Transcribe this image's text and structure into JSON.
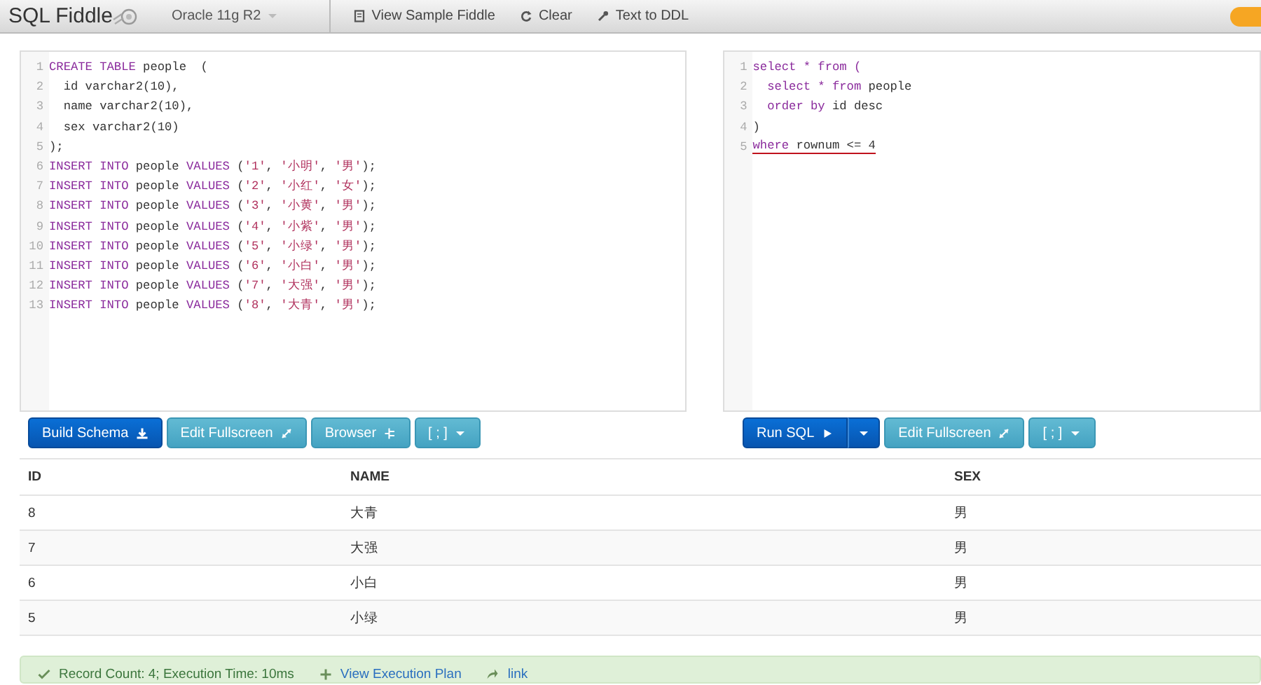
{
  "header": {
    "brand": "SQL Fiddle",
    "database": "Oracle 11g R2",
    "nav": [
      {
        "kind": "sample",
        "label": "View Sample Fiddle"
      },
      {
        "kind": "clear",
        "label": "Clear"
      },
      {
        "kind": "ddl",
        "label": "Text to DDL"
      }
    ]
  },
  "schema_editor": {
    "lines": [
      {
        "number": "1",
        "tokens": [
          {
            "kind": "keyword",
            "text": "CREATE TABLE"
          },
          {
            "kind": "plain",
            "text": " people  ("
          }
        ]
      },
      {
        "number": "2",
        "tokens": [
          {
            "kind": "plain",
            "text": "  id varchar2(10),"
          }
        ]
      },
      {
        "number": "3",
        "tokens": [
          {
            "kind": "plain",
            "text": "  name varchar2(10),"
          }
        ]
      },
      {
        "number": "4",
        "tokens": [
          {
            "kind": "plain",
            "text": "  sex varchar2(10)"
          }
        ]
      },
      {
        "number": "5",
        "tokens": [
          {
            "kind": "plain",
            "text": ");"
          }
        ]
      },
      {
        "number": "6",
        "tokens": [
          {
            "kind": "keyword",
            "text": "INSERT INTO"
          },
          {
            "kind": "plain",
            "text": " people "
          },
          {
            "kind": "keyword",
            "text": "VALUES"
          },
          {
            "kind": "plain",
            "text": " ("
          },
          {
            "kind": "string",
            "text": "'1'"
          },
          {
            "kind": "plain",
            "text": ", "
          },
          {
            "kind": "string",
            "text": "'小明'"
          },
          {
            "kind": "plain",
            "text": ", "
          },
          {
            "kind": "string",
            "text": "'男'"
          },
          {
            "kind": "plain",
            "text": ");"
          }
        ]
      },
      {
        "number": "7",
        "tokens": [
          {
            "kind": "keyword",
            "text": "INSERT INTO"
          },
          {
            "kind": "plain",
            "text": " people "
          },
          {
            "kind": "keyword",
            "text": "VALUES"
          },
          {
            "kind": "plain",
            "text": " ("
          },
          {
            "kind": "string",
            "text": "'2'"
          },
          {
            "kind": "plain",
            "text": ", "
          },
          {
            "kind": "string",
            "text": "'小红'"
          },
          {
            "kind": "plain",
            "text": ", "
          },
          {
            "kind": "string",
            "text": "'女'"
          },
          {
            "kind": "plain",
            "text": ");"
          }
        ]
      },
      {
        "number": "8",
        "tokens": [
          {
            "kind": "keyword",
            "text": "INSERT INTO"
          },
          {
            "kind": "plain",
            "text": " people "
          },
          {
            "kind": "keyword",
            "text": "VALUES"
          },
          {
            "kind": "plain",
            "text": " ("
          },
          {
            "kind": "string",
            "text": "'3'"
          },
          {
            "kind": "plain",
            "text": ", "
          },
          {
            "kind": "string",
            "text": "'小黄'"
          },
          {
            "kind": "plain",
            "text": ", "
          },
          {
            "kind": "string",
            "text": "'男'"
          },
          {
            "kind": "plain",
            "text": ");"
          }
        ]
      },
      {
        "number": "9",
        "tokens": [
          {
            "kind": "keyword",
            "text": "INSERT INTO"
          },
          {
            "kind": "plain",
            "text": " people "
          },
          {
            "kind": "keyword",
            "text": "VALUES"
          },
          {
            "kind": "plain",
            "text": " ("
          },
          {
            "kind": "string",
            "text": "'4'"
          },
          {
            "kind": "plain",
            "text": ", "
          },
          {
            "kind": "string",
            "text": "'小紫'"
          },
          {
            "kind": "plain",
            "text": ", "
          },
          {
            "kind": "string",
            "text": "'男'"
          },
          {
            "kind": "plain",
            "text": ");"
          }
        ]
      },
      {
        "number": "10",
        "tokens": [
          {
            "kind": "keyword",
            "text": "INSERT INTO"
          },
          {
            "kind": "plain",
            "text": " people "
          },
          {
            "kind": "keyword",
            "text": "VALUES"
          },
          {
            "kind": "plain",
            "text": " ("
          },
          {
            "kind": "string",
            "text": "'5'"
          },
          {
            "kind": "plain",
            "text": ", "
          },
          {
            "kind": "string",
            "text": "'小绿'"
          },
          {
            "kind": "plain",
            "text": ", "
          },
          {
            "kind": "string",
            "text": "'男'"
          },
          {
            "kind": "plain",
            "text": ");"
          }
        ]
      },
      {
        "number": "11",
        "tokens": [
          {
            "kind": "keyword",
            "text": "INSERT INTO"
          },
          {
            "kind": "plain",
            "text": " people "
          },
          {
            "kind": "keyword",
            "text": "VALUES"
          },
          {
            "kind": "plain",
            "text": " ("
          },
          {
            "kind": "string",
            "text": "'6'"
          },
          {
            "kind": "plain",
            "text": ", "
          },
          {
            "kind": "string",
            "text": "'小白'"
          },
          {
            "kind": "plain",
            "text": ", "
          },
          {
            "kind": "string",
            "text": "'男'"
          },
          {
            "kind": "plain",
            "text": ");"
          }
        ]
      },
      {
        "number": "12",
        "tokens": [
          {
            "kind": "keyword",
            "text": "INSERT INTO"
          },
          {
            "kind": "plain",
            "text": " people "
          },
          {
            "kind": "keyword",
            "text": "VALUES"
          },
          {
            "kind": "plain",
            "text": " ("
          },
          {
            "kind": "string",
            "text": "'7'"
          },
          {
            "kind": "plain",
            "text": ", "
          },
          {
            "kind": "string",
            "text": "'大强'"
          },
          {
            "kind": "plain",
            "text": ", "
          },
          {
            "kind": "string",
            "text": "'男'"
          },
          {
            "kind": "plain",
            "text": ");"
          }
        ]
      },
      {
        "number": "13",
        "tokens": [
          {
            "kind": "keyword",
            "text": "INSERT INTO"
          },
          {
            "kind": "plain",
            "text": " people "
          },
          {
            "kind": "keyword",
            "text": "VALUES"
          },
          {
            "kind": "plain",
            "text": " ("
          },
          {
            "kind": "string",
            "text": "'8'"
          },
          {
            "kind": "plain",
            "text": ", "
          },
          {
            "kind": "string",
            "text": "'大青'"
          },
          {
            "kind": "plain",
            "text": ", "
          },
          {
            "kind": "string",
            "text": "'男'"
          },
          {
            "kind": "plain",
            "text": ");"
          }
        ]
      }
    ]
  },
  "schema_buttons": [
    {
      "kind": "build",
      "label": "Build Schema"
    },
    {
      "kind": "fullscreen",
      "label": "Edit Fullscreen"
    },
    {
      "kind": "browser",
      "label": "Browser"
    },
    {
      "kind": "delimiter",
      "label": "[ ; ]"
    }
  ],
  "query_editor": {
    "lines": [
      {
        "number": "1",
        "underlined": false,
        "tokens": [
          {
            "kind": "keyword",
            "text": "select * from ("
          }
        ]
      },
      {
        "number": "2",
        "underlined": false,
        "tokens": [
          {
            "kind": "keyword",
            "text": "  select * from"
          },
          {
            "kind": "plain",
            "text": " people"
          }
        ]
      },
      {
        "number": "3",
        "underlined": false,
        "tokens": [
          {
            "kind": "keyword",
            "text": "  order by"
          },
          {
            "kind": "plain",
            "text": " id desc"
          }
        ]
      },
      {
        "number": "4",
        "underlined": false,
        "tokens": [
          {
            "kind": "plain",
            "text": ")"
          }
        ]
      },
      {
        "number": "5",
        "underlined": true,
        "tokens": [
          {
            "kind": "keyword",
            "text": "where"
          },
          {
            "kind": "plain",
            "text": " rownum <= 4"
          }
        ]
      }
    ]
  },
  "query_buttons": [
    {
      "kind": "run",
      "label": "Run SQL"
    },
    {
      "kind": "split"
    },
    {
      "kind": "fullscreen",
      "label": "Edit Fullscreen"
    },
    {
      "kind": "delimiter",
      "label": "[ ; ]"
    }
  ],
  "results": {
    "columns": [
      "ID",
      "NAME",
      "SEX"
    ],
    "rows": [
      [
        "8",
        "大青",
        "男"
      ],
      [
        "7",
        "大强",
        "男"
      ],
      [
        "6",
        "小白",
        "男"
      ],
      [
        "5",
        "小绿",
        "男"
      ]
    ]
  },
  "status_bar": {
    "message": "Record Count: 4; Execution Time: 10ms",
    "links": [
      {
        "kind": "plan",
        "label": "View Execution Plan"
      },
      {
        "kind": "link",
        "label": "link"
      }
    ]
  }
}
